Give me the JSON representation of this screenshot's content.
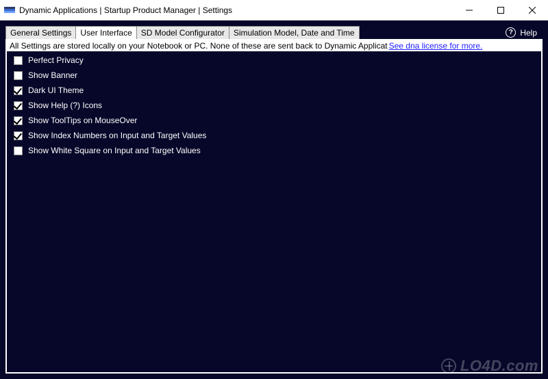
{
  "window": {
    "title": "Dynamic Applications | Startup Product Manager | Settings"
  },
  "tabs": [
    {
      "label": "General Settings",
      "active": false
    },
    {
      "label": "User Interface",
      "active": true
    },
    {
      "label": "SD Model Configurator",
      "active": false
    },
    {
      "label": "Simulation Model, Date and Time",
      "active": false
    }
  ],
  "help": {
    "label": "Help",
    "icon_glyph": "?"
  },
  "info_strip": {
    "text": "All Settings are stored locally on your Notebook or PC. None of these are sent back to Dynamic Applicat",
    "link_text": "See dna license for more."
  },
  "checkboxes": [
    {
      "label": "Perfect Privacy",
      "checked": false
    },
    {
      "label": "Show Banner",
      "checked": false
    },
    {
      "label": "Dark UI Theme",
      "checked": true
    },
    {
      "label": "Show Help (?) Icons",
      "checked": true
    },
    {
      "label": "Show ToolTips on MouseOver",
      "checked": true
    },
    {
      "label": "Show Index Numbers on Input and Target Values",
      "checked": true
    },
    {
      "label": "Show White Square on Input and Target Values",
      "checked": false
    }
  ],
  "watermark": {
    "text": "LO4D.com"
  },
  "colors": {
    "background_dark": "#07072a",
    "link": "#2020ff"
  }
}
